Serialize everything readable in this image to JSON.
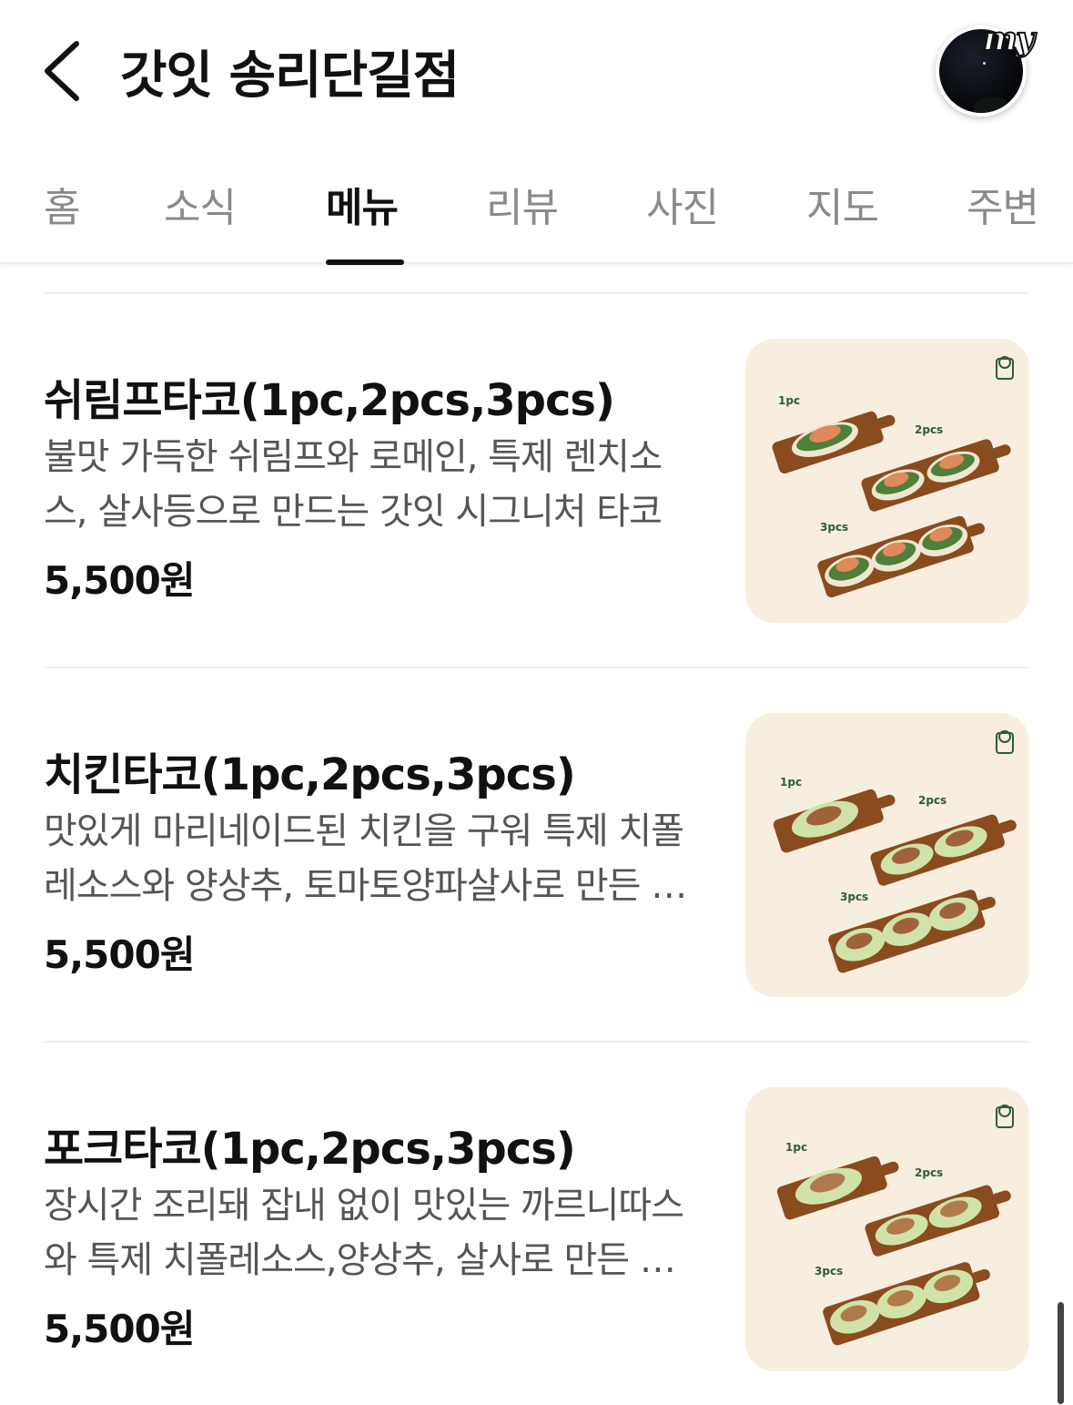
{
  "header": {
    "title": "갓잇 송리단길점",
    "my_label": "my"
  },
  "tabs": [
    {
      "label": "홈",
      "active": false
    },
    {
      "label": "소식",
      "active": false
    },
    {
      "label": "메뉴",
      "active": true
    },
    {
      "label": "리뷰",
      "active": false
    },
    {
      "label": "사진",
      "active": false
    },
    {
      "label": "지도",
      "active": false
    },
    {
      "label": "주변",
      "active": false
    }
  ],
  "menu": [
    {
      "name": "쉬림프타코(1pc,2pcs,3pcs)",
      "description": "불맛 가득한 쉬림프와 로메인, 특제 렌치소스, 살사등으로 만드는 갓잇 시그니처 타코",
      "price": "5,500원",
      "image": {
        "filling": "shrimp",
        "labels": [
          "1pc",
          "2pcs",
          "3pcs"
        ]
      }
    },
    {
      "name": "치킨타코(1pc,2pcs,3pcs)",
      "description": "맛있게 마리네이드된 치킨을 구워 특제 치폴레소스와 양상추, 토마토양파살사로 만든 타코",
      "price": "5,500원",
      "image": {
        "filling": "chicken",
        "labels": [
          "1pc",
          "2pcs",
          "3pcs"
        ]
      }
    },
    {
      "name": "포크타코(1pc,2pcs,3pcs)",
      "description": "장시간 조리돼 잡내 없이 맛있는 까르니따스와 특제 치폴레소스,양상추, 살사로 만든 타코",
      "price": "5,500원",
      "image": {
        "filling": "pork",
        "labels": [
          "1pc",
          "2pcs",
          "3pcs"
        ]
      }
    }
  ],
  "colors": {
    "thumb_bg": "#f7eedf",
    "board": "#8a4b1f",
    "tortilla": "#efe6cf",
    "shrimp_topping": "#e0895a",
    "lettuce_light": "#cfe3a8",
    "lettuce_dark": "#4f7f3a",
    "label_green": "#2f5b3e"
  }
}
